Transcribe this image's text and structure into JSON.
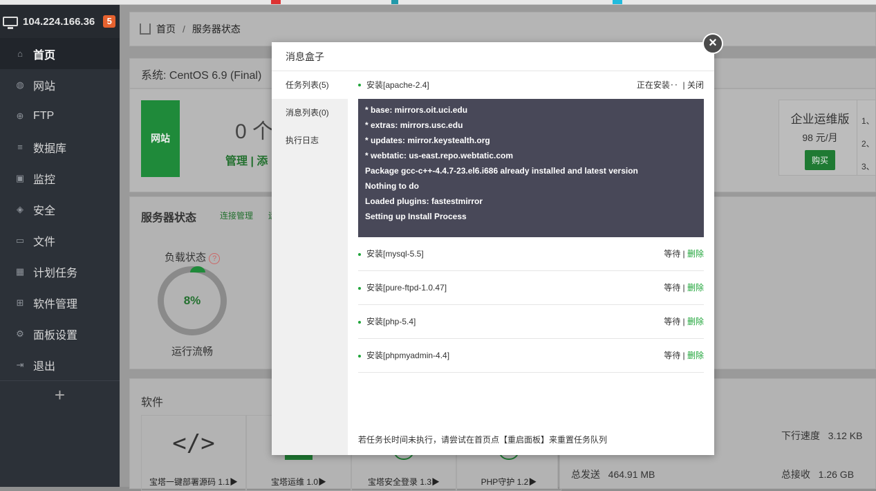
{
  "sidebar": {
    "host": "104.224.166.36",
    "badge": "5",
    "items": [
      {
        "label": "首页",
        "icon": "home-icon",
        "glyph": "⌂"
      },
      {
        "label": "网站",
        "icon": "globe-icon",
        "glyph": "◍"
      },
      {
        "label": "FTP",
        "icon": "ftp-icon",
        "glyph": "⊕"
      },
      {
        "label": "数据库",
        "icon": "database-icon",
        "glyph": "≡"
      },
      {
        "label": "监控",
        "icon": "monitor-icon",
        "glyph": "▣"
      },
      {
        "label": "安全",
        "icon": "shield-icon",
        "glyph": "◈"
      },
      {
        "label": "文件",
        "icon": "folder-icon",
        "glyph": "▭"
      },
      {
        "label": "计划任务",
        "icon": "calendar-icon",
        "glyph": "▦"
      },
      {
        "label": "软件管理",
        "icon": "apps-icon",
        "glyph": "⊞"
      },
      {
        "label": "面板设置",
        "icon": "gear-icon",
        "glyph": "⚙"
      },
      {
        "label": "退出",
        "icon": "logout-icon",
        "glyph": "⇥"
      }
    ],
    "add": "+"
  },
  "breadcrumb": {
    "home": "首页",
    "sep": "/",
    "current": "服务器状态"
  },
  "system": {
    "label": "系统: CentOS 6.9 (Final)"
  },
  "site": {
    "tag": "网站",
    "count": "0 个",
    "links": "管理 | 添"
  },
  "enterprise": {
    "title": "企业运维版",
    "price": "98 元/月",
    "buy": "购买",
    "list": [
      "1、",
      "2、",
      "3、"
    ]
  },
  "server": {
    "title": "服务器状态",
    "link": "连接管理",
    "link2": "运",
    "load_label": "负载状态",
    "load_value": "8%",
    "load_status": "运行流畅"
  },
  "software": {
    "title": "软件",
    "items": [
      "宝塔一键部署源码 1.1▶",
      "宝塔运维 1.0▶",
      "宝塔安全登录 1.3▶",
      "PHP守护 1.2▶"
    ]
  },
  "network": {
    "down_label": "下行速度",
    "down_value": "3.12 KB",
    "sent_label": "总发送",
    "sent_value": "464.91 MB",
    "recv_label": "总接收",
    "recv_value": "1.26 GB"
  },
  "modal": {
    "title": "消息盒子",
    "close": "×",
    "tabs": [
      "任务列表(5)",
      "消息列表(0)",
      "执行日志"
    ],
    "current_task": {
      "name": "安装[apache-2.4]",
      "status": "正在安装‥",
      "close": "| 关闭"
    },
    "log": [
      "* base: mirrors.oit.uci.edu",
      "* extras: mirrors.usc.edu",
      "* updates: mirror.keystealth.org",
      "* webtatic: us-east.repo.webtatic.com",
      "Package gcc-c++-4.4.7-23.el6.i686 already installed and latest version",
      "Nothing to do",
      "Loaded plugins: fastestmirror",
      "Setting up Install Process"
    ],
    "tasks": [
      {
        "name": "安装[mysql-5.5]",
        "wait": "等待 |",
        "del": "删除"
      },
      {
        "name": "安装[pure-ftpd-1.0.47]",
        "wait": "等待 |",
        "del": "删除"
      },
      {
        "name": "安装[php-5.4]",
        "wait": "等待 |",
        "del": "删除"
      },
      {
        "name": "安装[phpmyadmin-4.4]",
        "wait": "等待 |",
        "del": "删除"
      }
    ],
    "hint": "若任务长时间未执行，请尝试在首页点【重启面板】来重置任务队列"
  }
}
